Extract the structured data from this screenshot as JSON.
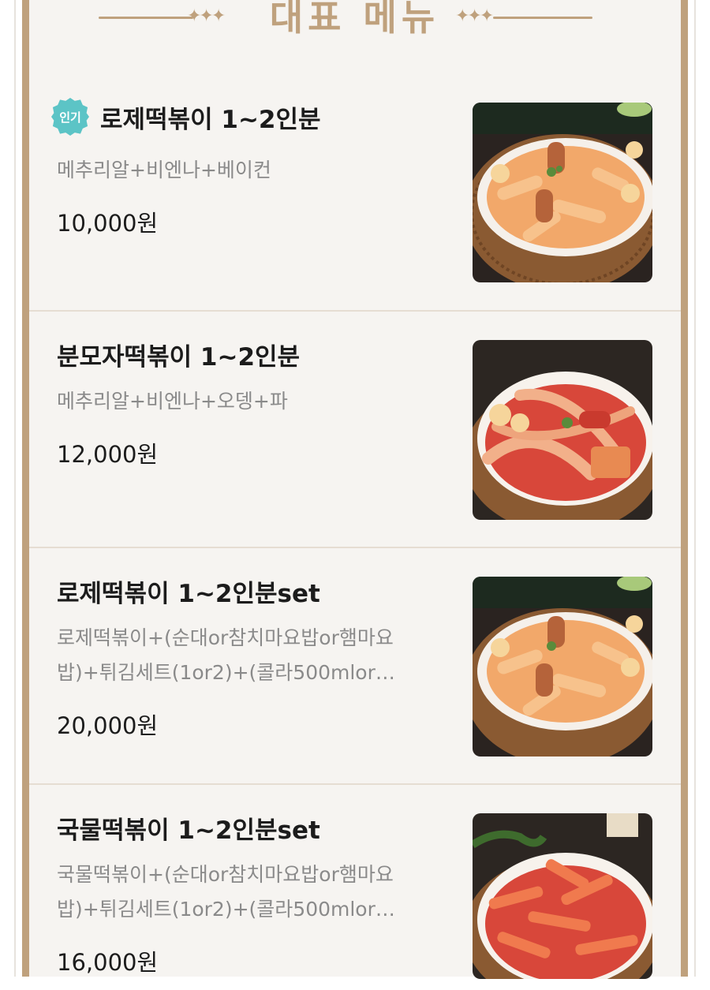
{
  "header": {
    "title": "대표 메뉴"
  },
  "items": [
    {
      "badge": "인기",
      "name": "로제떡볶이 1~2인분",
      "desc": "메추리알+비엔나+베이컨",
      "price": "10,000원",
      "image": "rose-tteokbokki-photo"
    },
    {
      "name": "분모자떡볶이 1~2인분",
      "desc": "메추리알+비엔나+오뎅+파",
      "price": "12,000원",
      "image": "bunmoja-tteokbokki-photo"
    },
    {
      "name": "로제떡볶이 1~2인분set",
      "desc": "로제떡볶이+(순대or참치마요밥or햄마요밥)+튀김세트(1or2)+(콜라500mlor…",
      "price": "20,000원",
      "image": "rose-tteokbokki-set-photo"
    },
    {
      "name": "국물떡볶이 1~2인분set",
      "desc": "국물떡볶이+(순대or참치마요밥or햄마요밥)+튀김세트(1or2)+(콜라500mlor…",
      "price": "16,000원",
      "image": "soup-tteokbokki-set-photo"
    }
  ],
  "colors": {
    "gold": "#bfa17d",
    "badge": "#5cc4c6",
    "rose_sauce": "#f2a86a",
    "red_sauce": "#d8473a"
  }
}
